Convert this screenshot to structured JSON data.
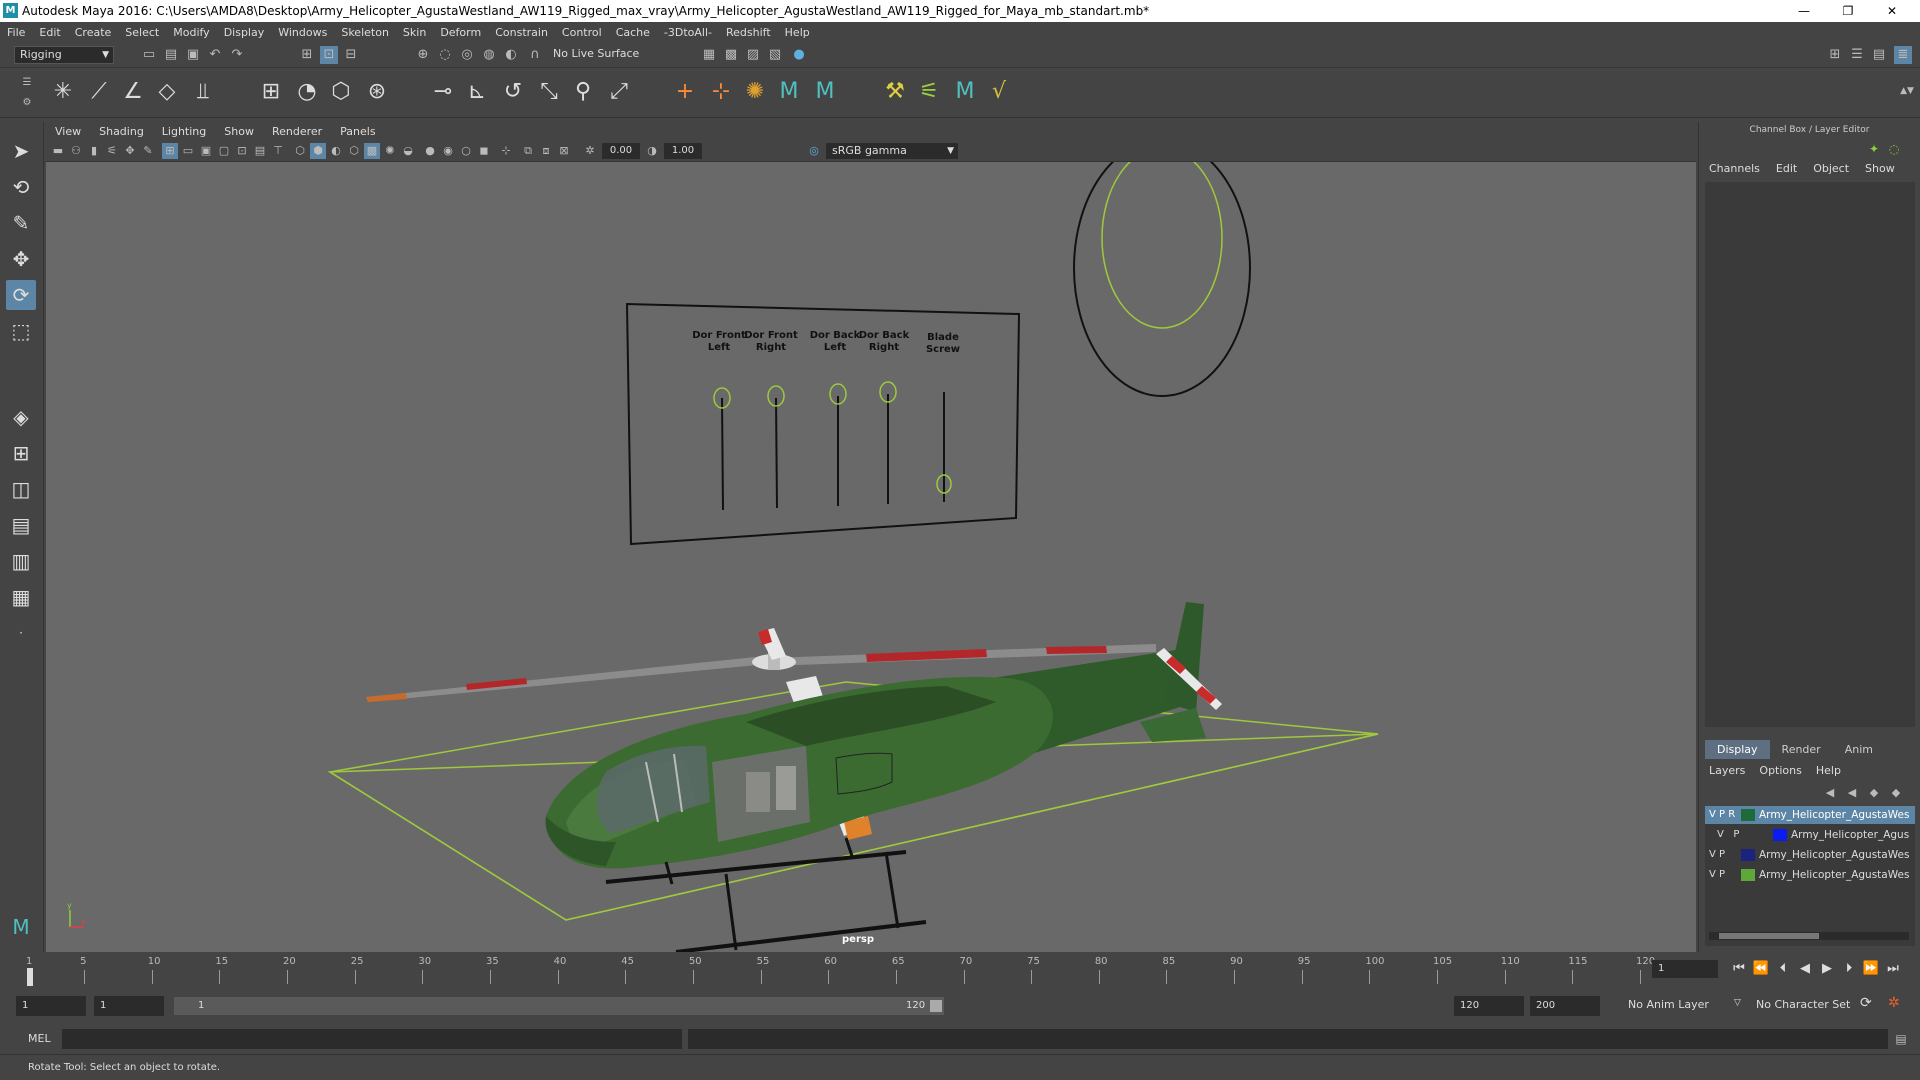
{
  "window": {
    "title": "Autodesk Maya 2016: C:\\Users\\AMDA8\\Desktop\\Army_Helicopter_AgustaWestland_AW119_Rigged_max_vray\\Army_Helicopter_AgustaWestland_AW119_Rigged_for_Maya_mb_standart.mb*",
    "minimize": "—",
    "restore": "❐",
    "close": "✕"
  },
  "menubar": [
    "File",
    "Edit",
    "Create",
    "Select",
    "Modify",
    "Display",
    "Windows",
    "Skeleton",
    "Skin",
    "Deform",
    "Constrain",
    "Control",
    "Cache",
    "-3DtoAll-",
    "Redshift",
    "Help"
  ],
  "statusline": {
    "mode": "Rigging",
    "live_surface": "No Live Surface"
  },
  "viewport": {
    "menu": [
      "View",
      "Shading",
      "Lighting",
      "Show",
      "Renderer",
      "Panels"
    ],
    "exposure": "0.00",
    "gamma": "1.00",
    "color_management": "sRGB gamma",
    "camera": "persp",
    "controls": {
      "labels": [
        [
          "Dor Front",
          "Left"
        ],
        [
          "Dor Front",
          "Right"
        ],
        [
          "Dor Back",
          "Left"
        ],
        [
          "Dor Back",
          "Right"
        ],
        [
          "Blade",
          "Screw"
        ]
      ]
    },
    "axis": {
      "x": "x",
      "y": "y"
    }
  },
  "channel_box": {
    "title": "Channel Box / Layer Editor",
    "menu": [
      "Channels",
      "Edit",
      "Object",
      "Show"
    ]
  },
  "layer_editor": {
    "tabs": [
      "Display",
      "Render",
      "Anim"
    ],
    "menu": [
      "Layers",
      "Options",
      "Help"
    ],
    "layers": [
      {
        "v": "V",
        "p": "P",
        "r": "R",
        "name": "Army_Helicopter_AgustaWes",
        "color": "#1f6a3a",
        "selected": true
      },
      {
        "v": "V",
        "p": "P",
        "r": "",
        "name": "Army_Helicopter_Agus",
        "color": "#0a1cf0",
        "selected": false
      },
      {
        "v": "V",
        "p": "P",
        "r": "",
        "name": "Army_Helicopter_AgustaWes",
        "color": "#1a237e",
        "selected": false
      },
      {
        "v": "V",
        "p": "P",
        "r": "",
        "name": "Army_Helicopter_AgustaWes",
        "color": "#5ea83a",
        "selected": false
      }
    ]
  },
  "timeline": {
    "ticks": [
      "1",
      "5",
      "10",
      "15",
      "20",
      "25",
      "30",
      "35",
      "40",
      "45",
      "50",
      "55",
      "60",
      "65",
      "70",
      "75",
      "80",
      "85",
      "90",
      "95",
      "100",
      "105",
      "110",
      "115",
      "120"
    ],
    "current_frame": "1"
  },
  "range": {
    "start": "1",
    "playback_start": "1",
    "slider_start": "1",
    "slider_end": "120",
    "playback_end": "120",
    "end": "200",
    "anim_layer": "No Anim Layer",
    "character_set": "No Character Set"
  },
  "command": {
    "language": "MEL"
  },
  "help_line": "Rotate Tool: Select an object to rotate."
}
